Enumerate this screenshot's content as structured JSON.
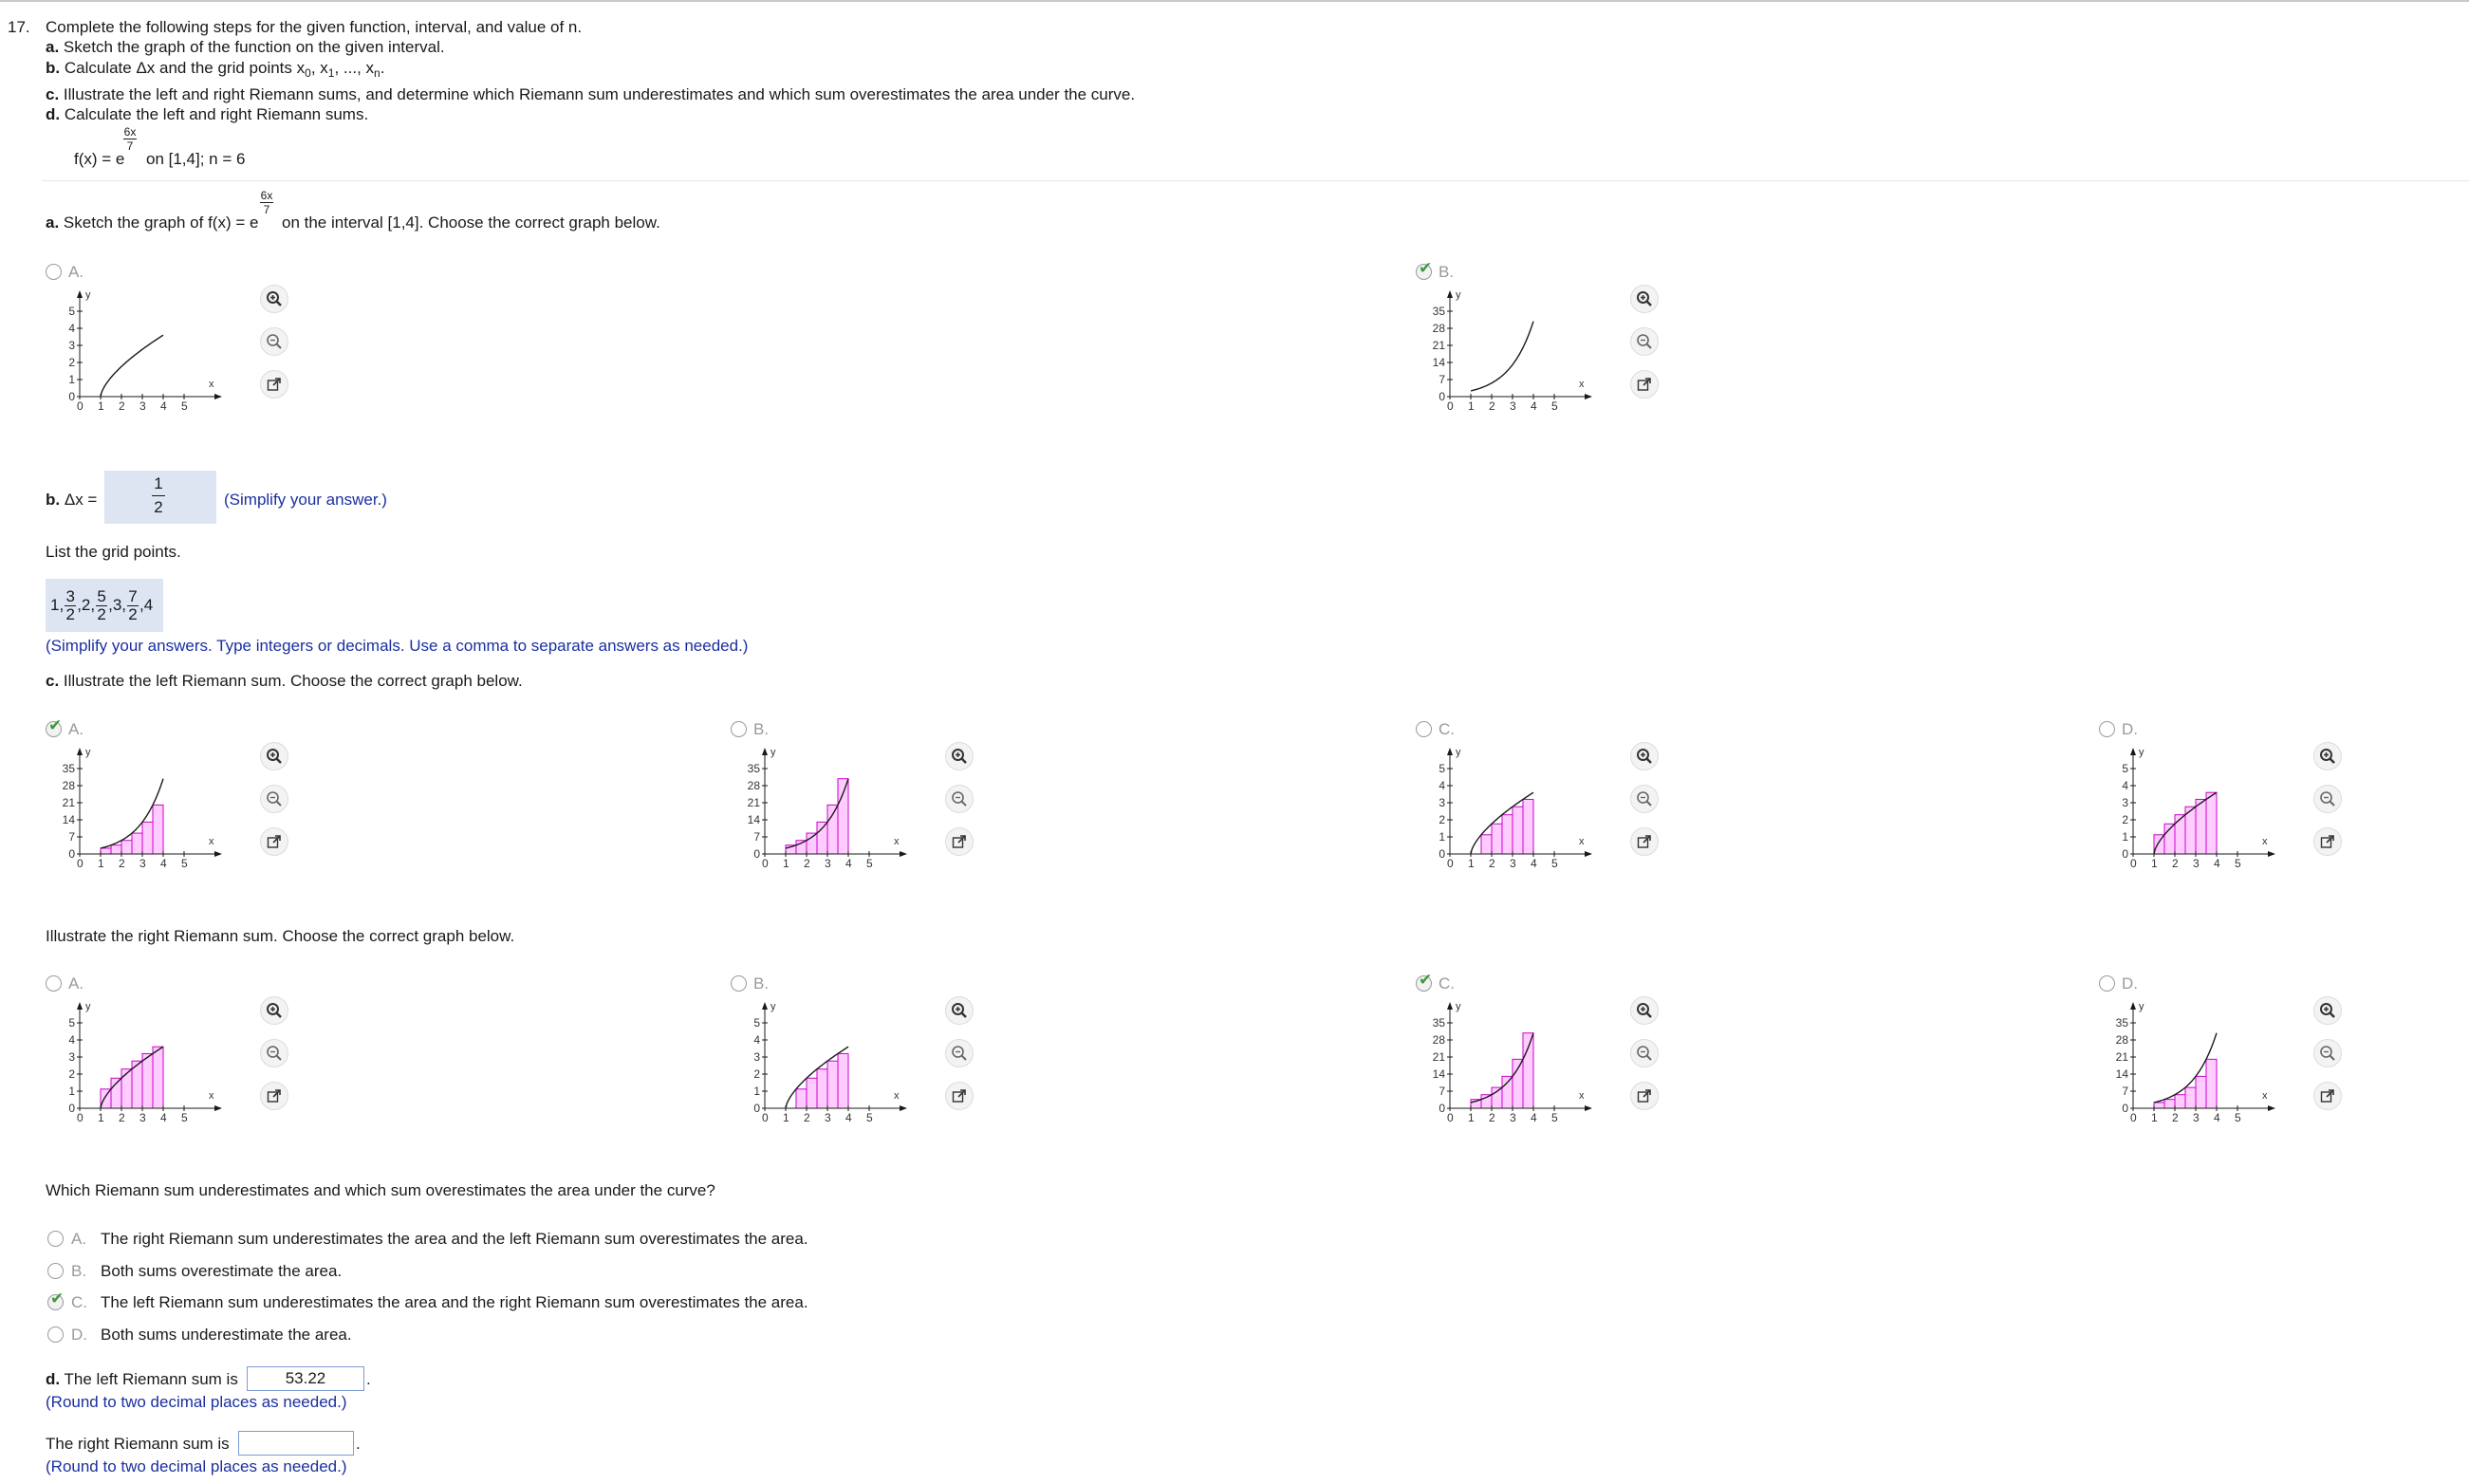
{
  "question": {
    "number": "17.",
    "intro": "Complete the following steps for the given function, interval, and value of n.",
    "steps": {
      "a_label": "a.",
      "a_text": "Sketch the graph of the function on the given interval.",
      "b_label": "b.",
      "b_text_pre": "Calculate Δx and the grid points x",
      "b_sub0": "0",
      "b_sep1": ", x",
      "b_sub1": "1",
      "b_sep2": ", ..., x",
      "b_subn": "n",
      "b_end": ".",
      "c_label": "c.",
      "c_text": "Illustrate the left and right Riemann sums, and determine which Riemann sum underestimates and which sum overestimates the area under the curve.",
      "d_label": "d.",
      "d_text": "Calculate the left and right Riemann sums."
    },
    "function": {
      "lhs": "f(x) = e",
      "exp_num": "6x",
      "exp_den": "7",
      "rest": "on [1,4]; n = 6"
    }
  },
  "part_a": {
    "label": "a.",
    "text_pre": "Sketch the graph of f(x) = e",
    "exp_num": "6x",
    "exp_den": "7",
    "text_post": "on the interval [1,4]. Choose the correct graph below.",
    "options": [
      {
        "letter": "A.",
        "checked": false,
        "yticks": [
          "5",
          "4",
          "3",
          "2",
          "1",
          "0"
        ]
      },
      {
        "letter": "B.",
        "checked": true,
        "yticks": [
          "35",
          "28",
          "21",
          "14",
          "7",
          "0"
        ]
      }
    ]
  },
  "part_b": {
    "label": "b.",
    "dx_text": "Δx =",
    "dx_num": "1",
    "dx_den": "2",
    "hint": "(Simplify your answer.)",
    "grid_prompt": "List the grid points.",
    "grid_tokens": [
      {
        "t": "1,"
      },
      {
        "n": "3",
        "d": "2"
      },
      {
        "t": ",2,"
      },
      {
        "n": "5",
        "d": "2"
      },
      {
        "t": ",3,"
      },
      {
        "n": "7",
        "d": "2"
      },
      {
        "t": ",4"
      }
    ],
    "grid_hint": "(Simplify your answers. Type integers or decimals. Use a comma to separate answers as needed.)"
  },
  "part_c": {
    "label": "c.",
    "left_text": "Illustrate the left Riemann sum. Choose the correct graph below.",
    "right_text": "Illustrate the right Riemann sum. Choose the correct graph below.",
    "left_options": [
      {
        "letter": "A.",
        "checked": true
      },
      {
        "letter": "B.",
        "checked": false
      },
      {
        "letter": "C.",
        "checked": false
      },
      {
        "letter": "D.",
        "checked": false
      }
    ],
    "right_options": [
      {
        "letter": "A.",
        "checked": false
      },
      {
        "letter": "B.",
        "checked": false
      },
      {
        "letter": "C.",
        "checked": true
      },
      {
        "letter": "D.",
        "checked": false
      }
    ],
    "compare_prompt": "Which Riemann sum underestimates and which sum overestimates the area under the curve?",
    "compare_options": [
      {
        "letter": "A.",
        "text": "The right Riemann sum underestimates the area and the left Riemann sum overestimates the area.",
        "checked": false
      },
      {
        "letter": "B.",
        "text": "Both sums overestimate the area.",
        "checked": false
      },
      {
        "letter": "C.",
        "text": "The left Riemann sum underestimates the area and the right Riemann sum overestimates the area.",
        "checked": true
      },
      {
        "letter": "D.",
        "text": "Both sums underestimate the area.",
        "checked": false
      }
    ]
  },
  "part_d": {
    "label": "d.",
    "left_text": "The left Riemann sum is",
    "left_value": "53.22",
    "left_hint": "(Round to two decimal places as needed.)",
    "right_text": "The right Riemann sum is",
    "right_value": "",
    "right_hint": "(Round to two decimal places as needed.)",
    "period": "."
  },
  "graph_labels": {
    "x_axis": "x",
    "y_axis": "y",
    "xticks": [
      "0",
      "1",
      "2",
      "3",
      "4",
      "5"
    ],
    "yticks_small": [
      "5",
      "4",
      "3",
      "2",
      "1",
      "0"
    ],
    "yticks_large": [
      "35",
      "28",
      "21",
      "14",
      "7",
      "0"
    ]
  },
  "colors": {
    "rect_fill": "#ffccff",
    "rect_stroke": "#cc00cc",
    "accent_blue": "#1a2fa0",
    "check_green": "#3c9a3c"
  }
}
